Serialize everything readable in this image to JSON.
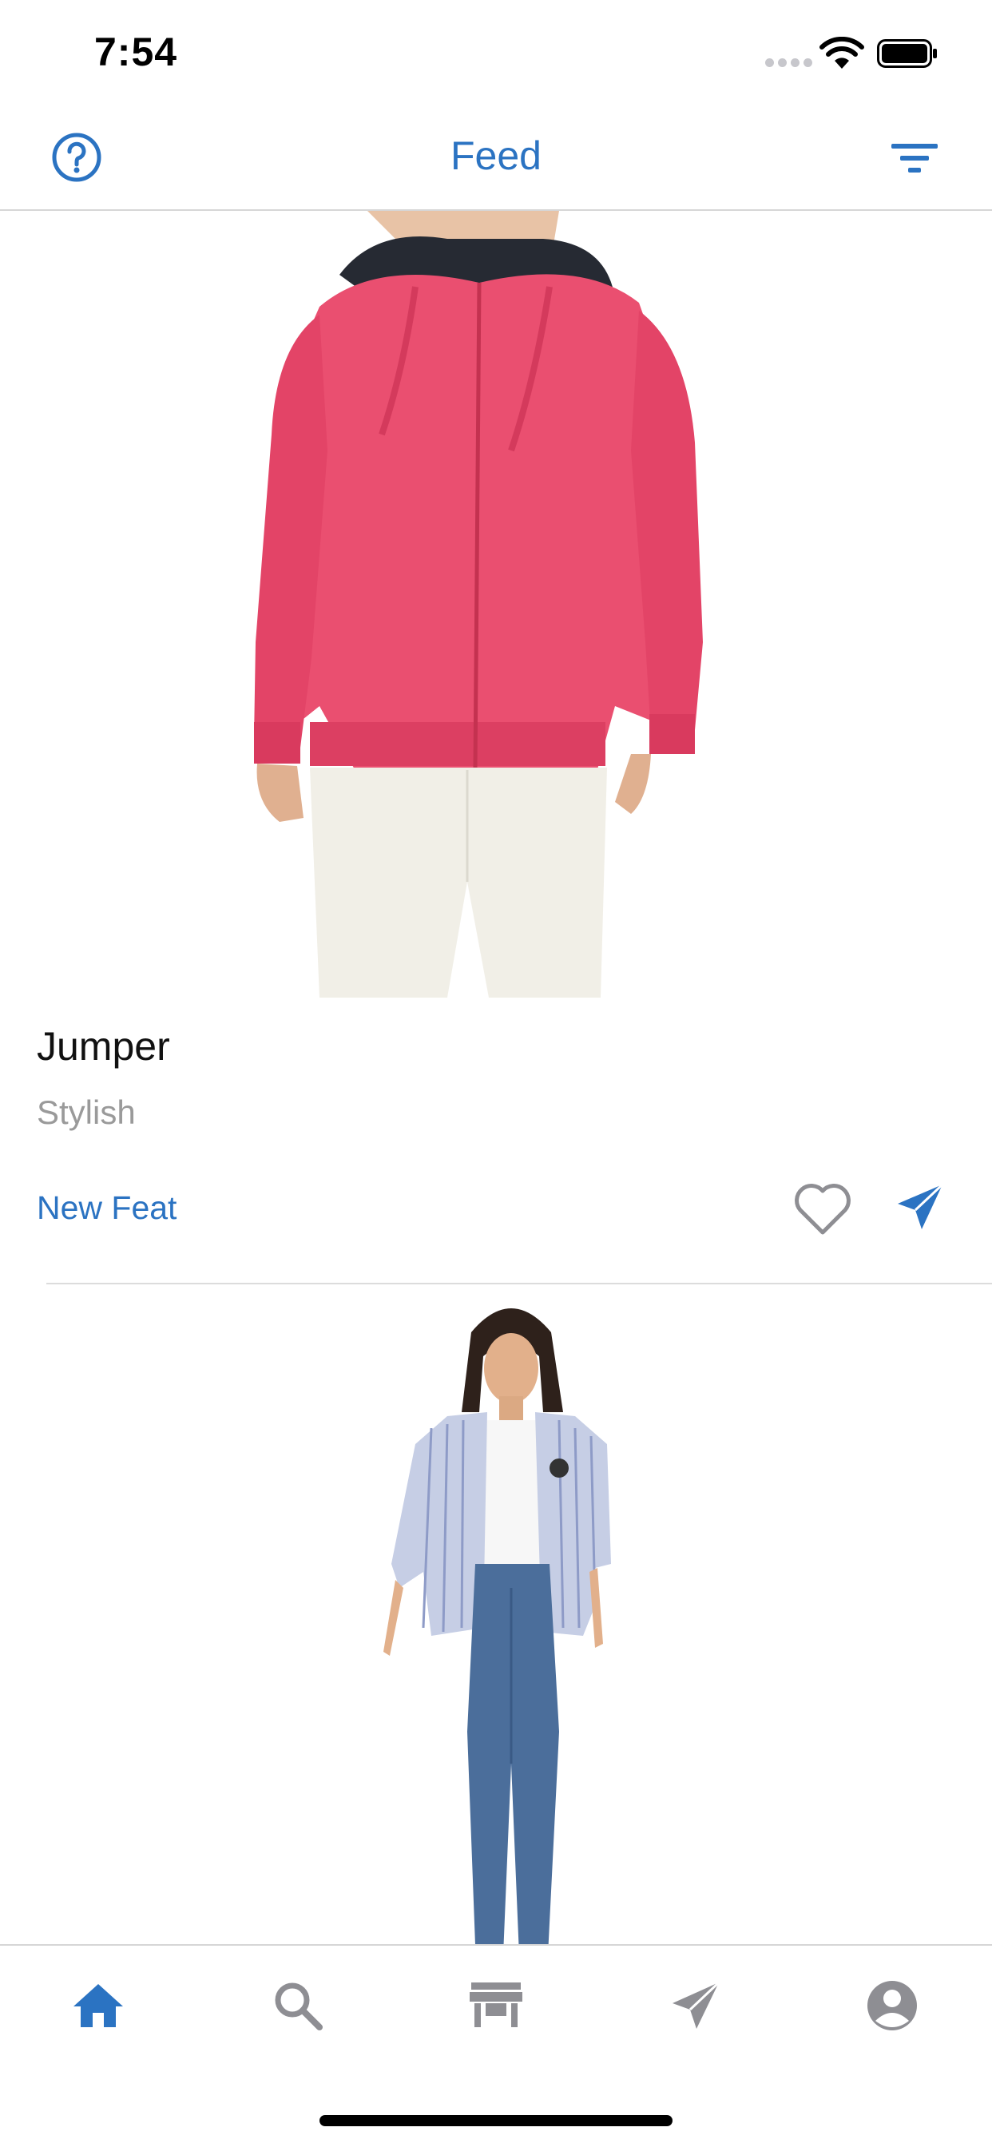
{
  "status_bar": {
    "time": "7:54"
  },
  "nav": {
    "title": "Feed",
    "left_icon": "help-icon",
    "right_icon": "filter-icon"
  },
  "colors": {
    "accent": "#2b73c2",
    "inactive": "#8e8e93",
    "secondary_text": "#9a9a9a",
    "divider": "#d6d6d6"
  },
  "feed": {
    "items": [
      {
        "title": "Jumper",
        "subtitle": "Stylish",
        "tag": "New Feat",
        "image": "pink-zip-hoodie-photo",
        "like_icon": "heart-outline-icon",
        "share_icon": "paper-plane-icon"
      },
      {
        "title": "",
        "subtitle": "",
        "tag": "",
        "image": "striped-shirt-jeans-photo"
      }
    ]
  },
  "tab_bar": {
    "tabs": [
      {
        "icon": "home-icon",
        "active": true
      },
      {
        "icon": "search-icon",
        "active": false
      },
      {
        "icon": "store-icon",
        "active": false
      },
      {
        "icon": "send-icon",
        "active": false
      },
      {
        "icon": "profile-icon",
        "active": false
      }
    ]
  }
}
